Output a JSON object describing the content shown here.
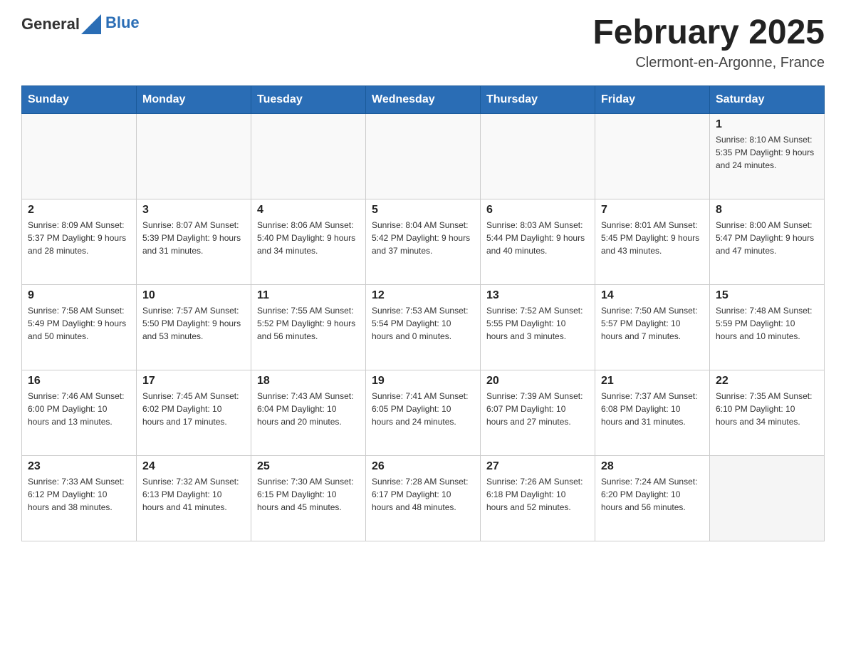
{
  "header": {
    "logo_general": "General",
    "logo_blue": "Blue",
    "month_title": "February 2025",
    "location": "Clermont-en-Argonne, France"
  },
  "days_of_week": [
    "Sunday",
    "Monday",
    "Tuesday",
    "Wednesday",
    "Thursday",
    "Friday",
    "Saturday"
  ],
  "weeks": [
    [
      {
        "day": "",
        "info": ""
      },
      {
        "day": "",
        "info": ""
      },
      {
        "day": "",
        "info": ""
      },
      {
        "day": "",
        "info": ""
      },
      {
        "day": "",
        "info": ""
      },
      {
        "day": "",
        "info": ""
      },
      {
        "day": "1",
        "info": "Sunrise: 8:10 AM\nSunset: 5:35 PM\nDaylight: 9 hours and 24 minutes."
      }
    ],
    [
      {
        "day": "2",
        "info": "Sunrise: 8:09 AM\nSunset: 5:37 PM\nDaylight: 9 hours and 28 minutes."
      },
      {
        "day": "3",
        "info": "Sunrise: 8:07 AM\nSunset: 5:39 PM\nDaylight: 9 hours and 31 minutes."
      },
      {
        "day": "4",
        "info": "Sunrise: 8:06 AM\nSunset: 5:40 PM\nDaylight: 9 hours and 34 minutes."
      },
      {
        "day": "5",
        "info": "Sunrise: 8:04 AM\nSunset: 5:42 PM\nDaylight: 9 hours and 37 minutes."
      },
      {
        "day": "6",
        "info": "Sunrise: 8:03 AM\nSunset: 5:44 PM\nDaylight: 9 hours and 40 minutes."
      },
      {
        "day": "7",
        "info": "Sunrise: 8:01 AM\nSunset: 5:45 PM\nDaylight: 9 hours and 43 minutes."
      },
      {
        "day": "8",
        "info": "Sunrise: 8:00 AM\nSunset: 5:47 PM\nDaylight: 9 hours and 47 minutes."
      }
    ],
    [
      {
        "day": "9",
        "info": "Sunrise: 7:58 AM\nSunset: 5:49 PM\nDaylight: 9 hours and 50 minutes."
      },
      {
        "day": "10",
        "info": "Sunrise: 7:57 AM\nSunset: 5:50 PM\nDaylight: 9 hours and 53 minutes."
      },
      {
        "day": "11",
        "info": "Sunrise: 7:55 AM\nSunset: 5:52 PM\nDaylight: 9 hours and 56 minutes."
      },
      {
        "day": "12",
        "info": "Sunrise: 7:53 AM\nSunset: 5:54 PM\nDaylight: 10 hours and 0 minutes."
      },
      {
        "day": "13",
        "info": "Sunrise: 7:52 AM\nSunset: 5:55 PM\nDaylight: 10 hours and 3 minutes."
      },
      {
        "day": "14",
        "info": "Sunrise: 7:50 AM\nSunset: 5:57 PM\nDaylight: 10 hours and 7 minutes."
      },
      {
        "day": "15",
        "info": "Sunrise: 7:48 AM\nSunset: 5:59 PM\nDaylight: 10 hours and 10 minutes."
      }
    ],
    [
      {
        "day": "16",
        "info": "Sunrise: 7:46 AM\nSunset: 6:00 PM\nDaylight: 10 hours and 13 minutes."
      },
      {
        "day": "17",
        "info": "Sunrise: 7:45 AM\nSunset: 6:02 PM\nDaylight: 10 hours and 17 minutes."
      },
      {
        "day": "18",
        "info": "Sunrise: 7:43 AM\nSunset: 6:04 PM\nDaylight: 10 hours and 20 minutes."
      },
      {
        "day": "19",
        "info": "Sunrise: 7:41 AM\nSunset: 6:05 PM\nDaylight: 10 hours and 24 minutes."
      },
      {
        "day": "20",
        "info": "Sunrise: 7:39 AM\nSunset: 6:07 PM\nDaylight: 10 hours and 27 minutes."
      },
      {
        "day": "21",
        "info": "Sunrise: 7:37 AM\nSunset: 6:08 PM\nDaylight: 10 hours and 31 minutes."
      },
      {
        "day": "22",
        "info": "Sunrise: 7:35 AM\nSunset: 6:10 PM\nDaylight: 10 hours and 34 minutes."
      }
    ],
    [
      {
        "day": "23",
        "info": "Sunrise: 7:33 AM\nSunset: 6:12 PM\nDaylight: 10 hours and 38 minutes."
      },
      {
        "day": "24",
        "info": "Sunrise: 7:32 AM\nSunset: 6:13 PM\nDaylight: 10 hours and 41 minutes."
      },
      {
        "day": "25",
        "info": "Sunrise: 7:30 AM\nSunset: 6:15 PM\nDaylight: 10 hours and 45 minutes."
      },
      {
        "day": "26",
        "info": "Sunrise: 7:28 AM\nSunset: 6:17 PM\nDaylight: 10 hours and 48 minutes."
      },
      {
        "day": "27",
        "info": "Sunrise: 7:26 AM\nSunset: 6:18 PM\nDaylight: 10 hours and 52 minutes."
      },
      {
        "day": "28",
        "info": "Sunrise: 7:24 AM\nSunset: 6:20 PM\nDaylight: 10 hours and 56 minutes."
      },
      {
        "day": "",
        "info": ""
      }
    ]
  ]
}
